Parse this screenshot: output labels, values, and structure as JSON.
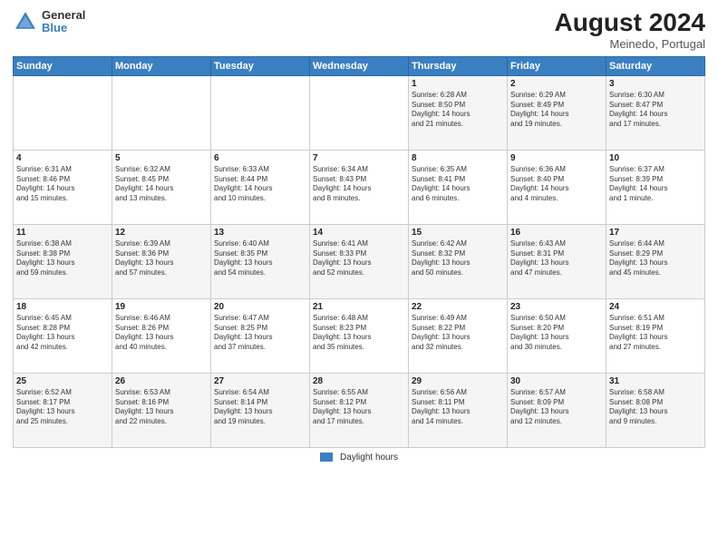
{
  "header": {
    "logo_general": "General",
    "logo_blue": "Blue",
    "month_year": "August 2024",
    "location": "Meinedo, Portugal"
  },
  "days_of_week": [
    "Sunday",
    "Monday",
    "Tuesday",
    "Wednesday",
    "Thursday",
    "Friday",
    "Saturday"
  ],
  "weeks": [
    [
      {
        "num": "",
        "info": ""
      },
      {
        "num": "",
        "info": ""
      },
      {
        "num": "",
        "info": ""
      },
      {
        "num": "",
        "info": ""
      },
      {
        "num": "1",
        "info": "Sunrise: 6:28 AM\nSunset: 8:50 PM\nDaylight: 14 hours\nand 21 minutes."
      },
      {
        "num": "2",
        "info": "Sunrise: 6:29 AM\nSunset: 8:49 PM\nDaylight: 14 hours\nand 19 minutes."
      },
      {
        "num": "3",
        "info": "Sunrise: 6:30 AM\nSunset: 8:47 PM\nDaylight: 14 hours\nand 17 minutes."
      }
    ],
    [
      {
        "num": "4",
        "info": "Sunrise: 6:31 AM\nSunset: 8:46 PM\nDaylight: 14 hours\nand 15 minutes."
      },
      {
        "num": "5",
        "info": "Sunrise: 6:32 AM\nSunset: 8:45 PM\nDaylight: 14 hours\nand 13 minutes."
      },
      {
        "num": "6",
        "info": "Sunrise: 6:33 AM\nSunset: 8:44 PM\nDaylight: 14 hours\nand 10 minutes."
      },
      {
        "num": "7",
        "info": "Sunrise: 6:34 AM\nSunset: 8:43 PM\nDaylight: 14 hours\nand 8 minutes."
      },
      {
        "num": "8",
        "info": "Sunrise: 6:35 AM\nSunset: 8:41 PM\nDaylight: 14 hours\nand 6 minutes."
      },
      {
        "num": "9",
        "info": "Sunrise: 6:36 AM\nSunset: 8:40 PM\nDaylight: 14 hours\nand 4 minutes."
      },
      {
        "num": "10",
        "info": "Sunrise: 6:37 AM\nSunset: 8:39 PM\nDaylight: 14 hours\nand 1 minute."
      }
    ],
    [
      {
        "num": "11",
        "info": "Sunrise: 6:38 AM\nSunset: 8:38 PM\nDaylight: 13 hours\nand 59 minutes."
      },
      {
        "num": "12",
        "info": "Sunrise: 6:39 AM\nSunset: 8:36 PM\nDaylight: 13 hours\nand 57 minutes."
      },
      {
        "num": "13",
        "info": "Sunrise: 6:40 AM\nSunset: 8:35 PM\nDaylight: 13 hours\nand 54 minutes."
      },
      {
        "num": "14",
        "info": "Sunrise: 6:41 AM\nSunset: 8:33 PM\nDaylight: 13 hours\nand 52 minutes."
      },
      {
        "num": "15",
        "info": "Sunrise: 6:42 AM\nSunset: 8:32 PM\nDaylight: 13 hours\nand 50 minutes."
      },
      {
        "num": "16",
        "info": "Sunrise: 6:43 AM\nSunset: 8:31 PM\nDaylight: 13 hours\nand 47 minutes."
      },
      {
        "num": "17",
        "info": "Sunrise: 6:44 AM\nSunset: 8:29 PM\nDaylight: 13 hours\nand 45 minutes."
      }
    ],
    [
      {
        "num": "18",
        "info": "Sunrise: 6:45 AM\nSunset: 8:28 PM\nDaylight: 13 hours\nand 42 minutes."
      },
      {
        "num": "19",
        "info": "Sunrise: 6:46 AM\nSunset: 8:26 PM\nDaylight: 13 hours\nand 40 minutes."
      },
      {
        "num": "20",
        "info": "Sunrise: 6:47 AM\nSunset: 8:25 PM\nDaylight: 13 hours\nand 37 minutes."
      },
      {
        "num": "21",
        "info": "Sunrise: 6:48 AM\nSunset: 8:23 PM\nDaylight: 13 hours\nand 35 minutes."
      },
      {
        "num": "22",
        "info": "Sunrise: 6:49 AM\nSunset: 8:22 PM\nDaylight: 13 hours\nand 32 minutes."
      },
      {
        "num": "23",
        "info": "Sunrise: 6:50 AM\nSunset: 8:20 PM\nDaylight: 13 hours\nand 30 minutes."
      },
      {
        "num": "24",
        "info": "Sunrise: 6:51 AM\nSunset: 8:19 PM\nDaylight: 13 hours\nand 27 minutes."
      }
    ],
    [
      {
        "num": "25",
        "info": "Sunrise: 6:52 AM\nSunset: 8:17 PM\nDaylight: 13 hours\nand 25 minutes."
      },
      {
        "num": "26",
        "info": "Sunrise: 6:53 AM\nSunset: 8:16 PM\nDaylight: 13 hours\nand 22 minutes."
      },
      {
        "num": "27",
        "info": "Sunrise: 6:54 AM\nSunset: 8:14 PM\nDaylight: 13 hours\nand 19 minutes."
      },
      {
        "num": "28",
        "info": "Sunrise: 6:55 AM\nSunset: 8:12 PM\nDaylight: 13 hours\nand 17 minutes."
      },
      {
        "num": "29",
        "info": "Sunrise: 6:56 AM\nSunset: 8:11 PM\nDaylight: 13 hours\nand 14 minutes."
      },
      {
        "num": "30",
        "info": "Sunrise: 6:57 AM\nSunset: 8:09 PM\nDaylight: 13 hours\nand 12 minutes."
      },
      {
        "num": "31",
        "info": "Sunrise: 6:58 AM\nSunset: 8:08 PM\nDaylight: 13 hours\nand 9 minutes."
      }
    ]
  ],
  "footer": {
    "legend_label": "Daylight hours"
  }
}
